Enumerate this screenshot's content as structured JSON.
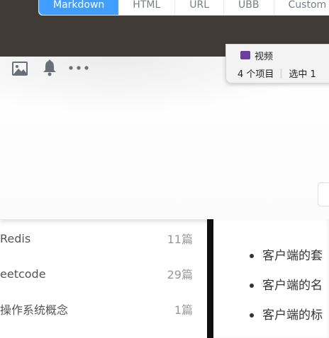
{
  "format_tabs": [
    "Markdown",
    "HTML",
    "URL",
    "UBB",
    "Custom"
  ],
  "active_tab": "Markdown",
  "accent_color": "#409eff",
  "toolbar": {
    "icons": [
      "image-icon",
      "bell-icon",
      "more-icon"
    ]
  },
  "explorer": {
    "folder_label": "视频",
    "item_count": "4 个项目",
    "selected": "选中 1"
  },
  "category_list": [
    {
      "name": "Redis",
      "count": "11篇"
    },
    {
      "name": "eetcode",
      "count": "29篇"
    },
    {
      "name": "操作系统概念",
      "count": "1篇"
    }
  ],
  "content": {
    "bullets": [
      "客户端的套",
      "客户端的名",
      "客户端的标"
    ]
  }
}
